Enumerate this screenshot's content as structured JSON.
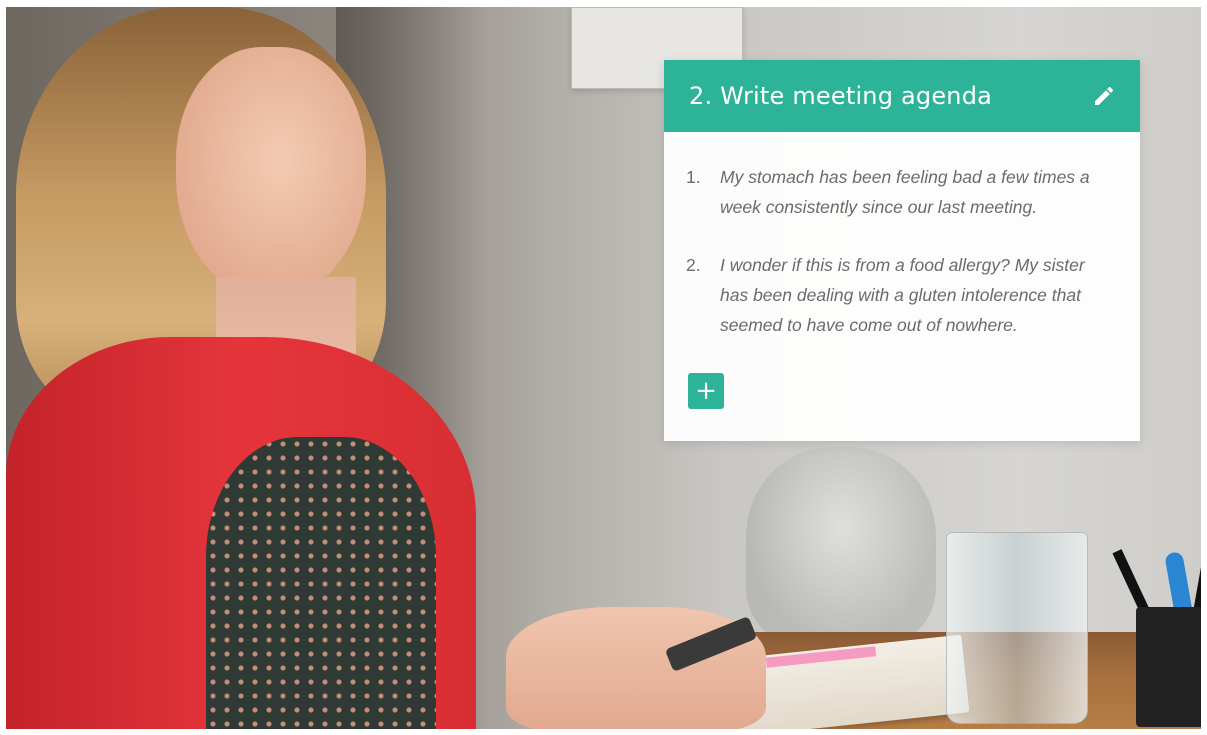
{
  "card": {
    "title": "2. Write meeting agenda",
    "edit_icon": "pencil-icon",
    "items": [
      {
        "number": "1.",
        "text": "My stomach has been feeling bad a few times a week consistently since our last meeting."
      },
      {
        "number": "2.",
        "text": "I wonder if this is from a food allergy? My sister has been dealing with a gluten intolerence that seemed to have come out of nowhere."
      }
    ],
    "add_label": "+"
  },
  "colors": {
    "accent": "#2db398",
    "item_text": "#6b6b6b"
  }
}
